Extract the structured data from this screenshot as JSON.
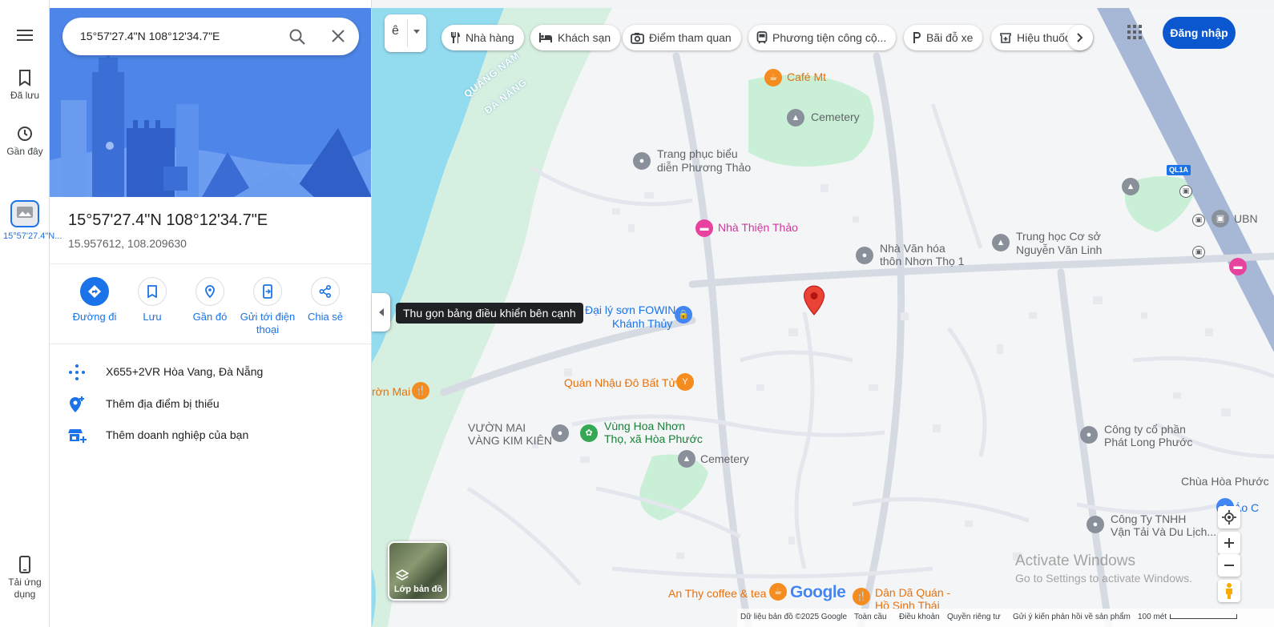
{
  "rail": {
    "saved": "Đã lưu",
    "recent": "Gần đây",
    "recent_item": "15°57'27.4\"N...",
    "get_app": "Tải ứng dụng"
  },
  "search": {
    "value": "15°57'27.4\"N 108°12'34.7\"E"
  },
  "place": {
    "title": "15°57'27.4\"N 108°12'34.7\"E",
    "coords": "15.957612, 108.209630"
  },
  "actions": {
    "directions": "Đường đi",
    "save": "Lưu",
    "nearby": "Gần đó",
    "send_phone": "Gửi tới điện thoại",
    "share": "Chia sẻ"
  },
  "info": {
    "plus_code": "X655+2VR Hòa Vang, Đà Nẵng",
    "add_missing": "Thêm địa điểm bị thiếu",
    "add_business": "Thêm doanh nghiệp của bạn"
  },
  "chips": [
    {
      "label": "Nhà hàng",
      "icon": "restaurant-icon"
    },
    {
      "label": "Khách sạn",
      "icon": "hotel-icon"
    },
    {
      "label": "Điểm tham quan",
      "icon": "camera-icon"
    },
    {
      "label": "Phương tiện công cộ...",
      "icon": "transit-icon"
    },
    {
      "label": "Bãi đỗ xe",
      "icon": "parking-icon"
    },
    {
      "label": "Hiệu thuốc",
      "icon": "pharmacy-icon"
    }
  ],
  "signin": "Đăng nhập",
  "tooltip": "Thu gọn bảng điều khiển bên cạnh",
  "layers_label": "Lớp bản đồ",
  "map_labels": {
    "province_a": "QUẢNG NAM",
    "province_b": "ĐÀ NẴNG",
    "highway": "QL1A",
    "cafe_mt": "Café Mt",
    "cemetery_top": "Cemetery",
    "trang_phuc_1": "Trang phục biểu",
    "trang_phuc_2": "diễn Phương Thảo",
    "nha_thien_thao": "Nhà Thiện Thảo",
    "nha_van_hoa_1": "Nhà Văn hóa",
    "nha_van_hoa_2": "thôn Nhơn Thọ 1",
    "trung_hoc_1": "Trung học Cơ sở",
    "trung_hoc_2": "Nguyễn Văn Linh",
    "ubn": "UBN",
    "dai_ly_1": "Đại lý sơn FOWIN",
    "dai_ly_2": "Khánh Thủy",
    "quan_nhau": "Quán Nhậu Đô Bất Tử",
    "vuon_mai_edge": "rờn Mai",
    "vuon_mai_1": "VƯỜN MAI",
    "vuon_mai_2": "VÀNG KIM KIÊN",
    "vung_hoa_1": "Vùng Hoa Nhơn",
    "vung_hoa_2": "Thọ, xã Hòa Phước",
    "cemetery_bottom": "Cemetery",
    "cong_ty_1": "Công ty cổ phần",
    "cong_ty_2": "Phát Long Phước",
    "chua_hoa_phuoc": "Chùa Hòa Phước",
    "ao": "Áo C",
    "cong_ty_tnhh_1": "Công Ty TNHH",
    "cong_ty_tnhh_2": "Vận Tải Và Du Lịch...",
    "an_thy": "An Thy coffee & tea",
    "dan_da_1": "Dân Dã Quán -",
    "dan_da_2": "Hồ Sinh Thái"
  },
  "google_logo": "Google",
  "watermark": {
    "line1": "Activate Windows",
    "line2": "Go to Settings to activate Windows."
  },
  "footer": {
    "data": "Dữ liệu bản đồ ©2025 Google",
    "global": "Toàn cầu",
    "terms": "Điều khoản",
    "privacy": "Quyền riêng tư",
    "feedback": "Gửi ý kiến phản hồi về sản phẩm",
    "scale": "100 mét"
  },
  "colors": {
    "accent": "#1a73e8",
    "signin": "#0b57d0",
    "marker": "#ea4335",
    "water": "#90daee",
    "park": "#c8f0d4"
  }
}
